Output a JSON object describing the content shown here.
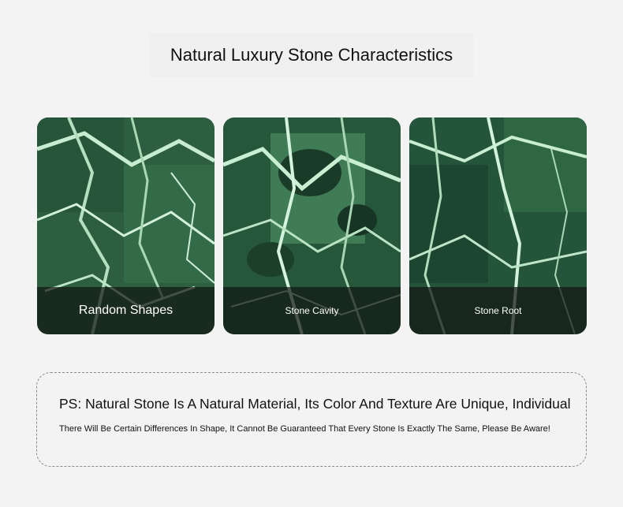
{
  "heading": "Natural Luxury Stone Characteristics",
  "cards": [
    {
      "label": "Random Shapes"
    },
    {
      "label": "Stone Cavity"
    },
    {
      "label": "Stone Root"
    }
  ],
  "note": {
    "line1": "PS: Natural Stone Is A Natural Material, Its Color And Texture Are Unique, Individual",
    "line2": "There Will Be Certain Differences In Shape, It Cannot Be Guaranteed That Every Stone Is Exactly The Same, Please Be Aware!"
  },
  "colors": {
    "background": "#f3f3f3",
    "stone_dark": "#1f4a32",
    "stone_mid": "#3f7a55",
    "vein_light": "#bfe6c8"
  }
}
